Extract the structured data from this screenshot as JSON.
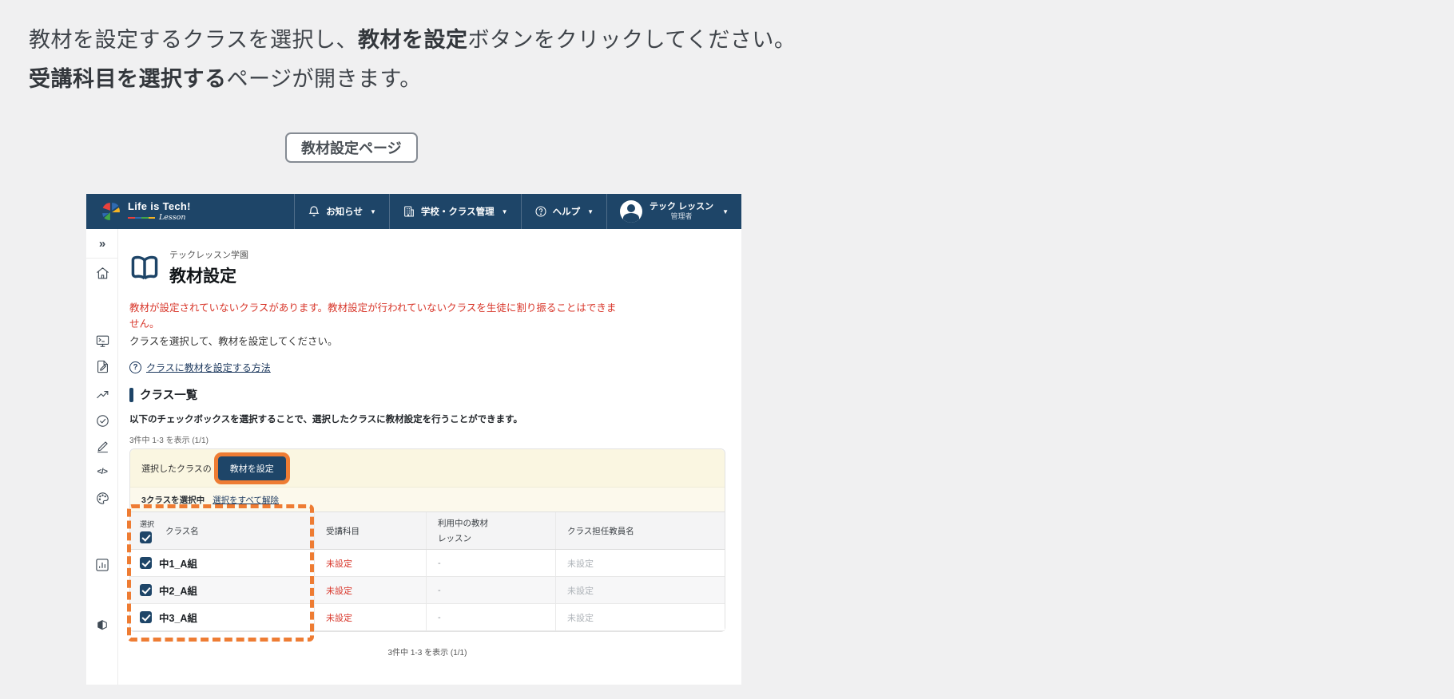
{
  "intro": {
    "line1_pre": "教材を設定するクラスを選択し、",
    "line1_bold": "教材を設定",
    "line1_post": "ボタンをクリックしてください。",
    "line2_bold": "受講科目を選択する",
    "line2_post": "ページが開きます。"
  },
  "page_label": "教材設定ページ",
  "app": {
    "header": {
      "logo_title": "Life is Tech!",
      "logo_sub": "Lesson",
      "nav": [
        {
          "label": "お知らせ",
          "icon": "bell-icon"
        },
        {
          "label": "学校・クラス管理",
          "icon": "school-building-icon"
        },
        {
          "label": "ヘルプ",
          "icon": "help-circle-icon"
        }
      ],
      "user": {
        "name": "テック レッスン",
        "role": "管理者"
      }
    },
    "sidebar": {
      "icons": [
        "collapse-icon",
        "home-icon",
        "terminal-monitor-icon",
        "document-edit-icon",
        "trend-up-icon",
        "check-circle-icon",
        "pencil-icon",
        "code-icon",
        "palette-icon",
        "bar-chart-icon",
        "beginner-book-icon"
      ]
    },
    "main": {
      "school_name": "テックレッスン学園",
      "page_title": "教材設定",
      "warning": "教材が設定されていないクラスがあります。教材設定が行われていないクラスを生徒に割り振ることはできません。",
      "instruction": "クラスを選択して、教材を設定してください。",
      "help_link": "クラスに教材を設定する方法",
      "section_title": "クラス一覧",
      "section_desc": "以下のチェックボックスを選択することで、選択したクラスに教材設定を行うことができます。",
      "count_top": "3件中 1-3 を表示 (1/1)",
      "count_bottom": "3件中 1-3 を表示 (1/1)",
      "toolbar": {
        "prefix": "選択したクラスの",
        "button_label": "教材を設定"
      },
      "selection": {
        "status": "3クラスを選択中",
        "clear_label": "選択をすべて解除"
      },
      "table": {
        "headers": {
          "select": "選択",
          "class_name": "クラス名",
          "subject": "受講科目",
          "material": "利用中の教材",
          "lesson": "レッスン",
          "teacher": "クラス担任教員名"
        },
        "rows": [
          {
            "name": "中1_A組",
            "subject": "未設定",
            "material": "-",
            "teacher": "未設定"
          },
          {
            "name": "中2_A組",
            "subject": "未設定",
            "material": "-",
            "teacher": "未設定"
          },
          {
            "name": "中3_A組",
            "subject": "未設定",
            "material": "-",
            "teacher": "未設定"
          }
        ]
      }
    }
  },
  "colors": {
    "navy": "#1e4568",
    "orange": "#ee7c33",
    "red": "#d8362a",
    "cream": "#faf6e1",
    "link": "#1e3a5f"
  }
}
